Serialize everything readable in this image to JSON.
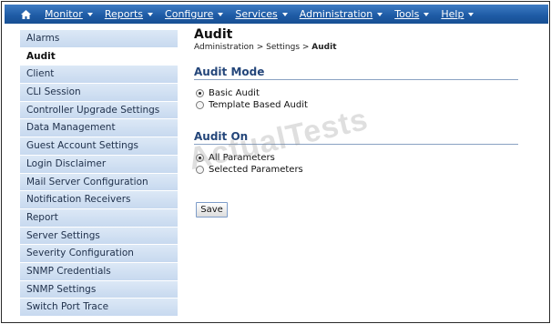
{
  "menubar": {
    "home_icon": "house-icon",
    "items": [
      {
        "label": "Monitor"
      },
      {
        "label": "Reports"
      },
      {
        "label": "Configure"
      },
      {
        "label": "Services"
      },
      {
        "label": "Administration"
      },
      {
        "label": "Tools"
      },
      {
        "label": "Help"
      }
    ]
  },
  "sidebar": {
    "items": [
      {
        "label": "Alarms"
      },
      {
        "label": "Audit"
      },
      {
        "label": "Client"
      },
      {
        "label": "CLI Session"
      },
      {
        "label": "Controller Upgrade Settings"
      },
      {
        "label": "Data Management"
      },
      {
        "label": "Guest Account Settings"
      },
      {
        "label": "Login Disclaimer"
      },
      {
        "label": "Mail Server Configuration"
      },
      {
        "label": "Notification Receivers"
      },
      {
        "label": "Report"
      },
      {
        "label": "Server Settings"
      },
      {
        "label": "Severity Configuration"
      },
      {
        "label": "SNMP Credentials"
      },
      {
        "label": "SNMP Settings"
      },
      {
        "label": "Switch Port Trace"
      }
    ],
    "active": "Audit"
  },
  "page": {
    "title": "Audit",
    "breadcrumb": {
      "prefix": "Administration > Settings > ",
      "current": "Audit"
    }
  },
  "audit_mode": {
    "title": "Audit Mode",
    "options": [
      {
        "label": "Basic Audit",
        "checked": true
      },
      {
        "label": "Template Based Audit",
        "checked": false
      }
    ]
  },
  "audit_on": {
    "title": "Audit On",
    "options": [
      {
        "label": "All Parameters",
        "checked": true
      },
      {
        "label": "Selected Parameters",
        "checked": false
      }
    ]
  },
  "save_label": "Save",
  "watermark": "ActualTests",
  "colors": {
    "menubar": "#1d5aa4",
    "sidebar_item": "#c7d9ef",
    "section_title": "#24467a"
  }
}
